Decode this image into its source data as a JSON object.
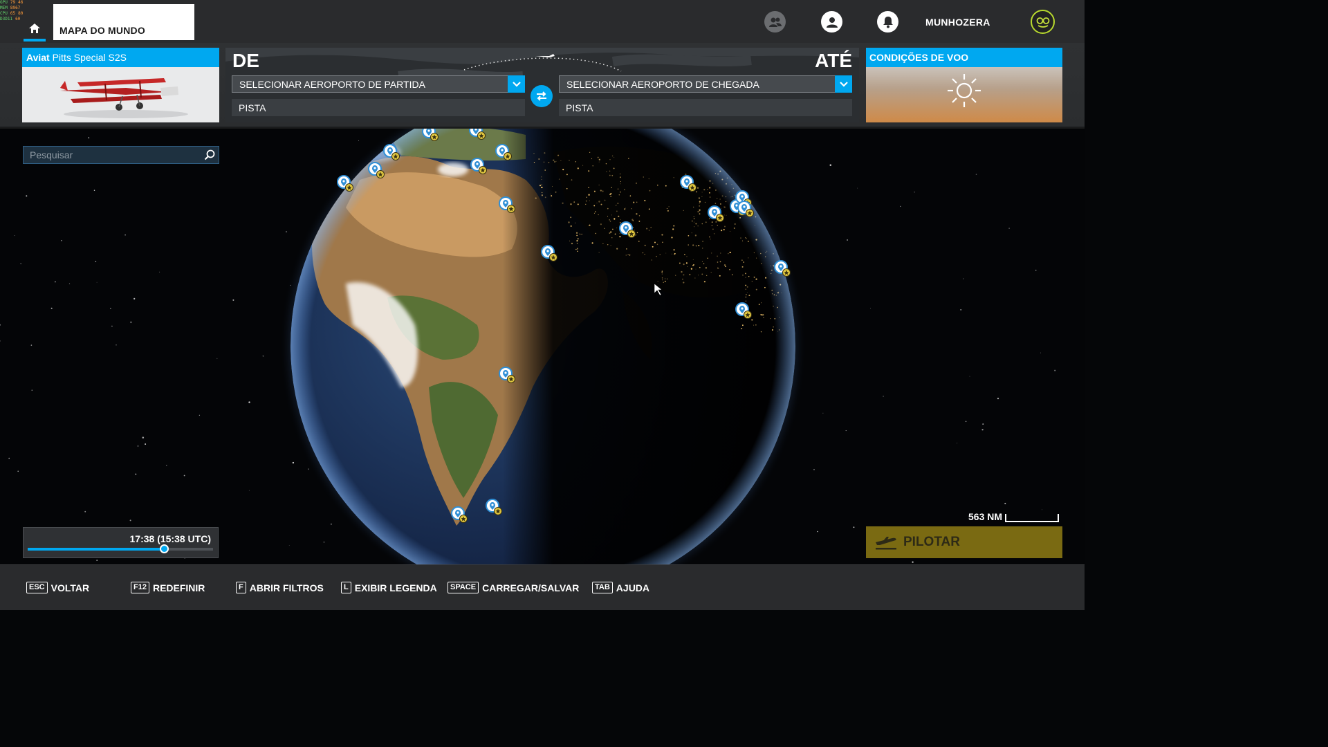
{
  "perf": {
    "rows": [
      {
        "label": "GPU",
        "value": "79",
        "extra": "46"
      },
      {
        "label": "MEM",
        "value": "8967",
        "extra": ""
      },
      {
        "label": "CPU",
        "value": "65",
        "extra": "80"
      },
      {
        "label": "D3D11",
        "value": "60",
        "extra": ""
      }
    ]
  },
  "header": {
    "breadcrumb": "MAPA DO MUNDO",
    "username": "MUNHOZERA"
  },
  "aircraft": {
    "maker": "Aviat",
    "model": "Pitts Special S2S"
  },
  "route": {
    "from_label": "DE",
    "to_label": "ATÉ",
    "departure_placeholder": "SELECIONAR AEROPORTO DE PARTIDA",
    "arrival_placeholder": "SELECIONAR AEROPORTO DE CHEGADA",
    "departure_runway": "PISTA",
    "arrival_runway": "PISTA"
  },
  "conditions": {
    "title": "CONDIÇÕES DE VOO",
    "weather_icon": "sun-icon"
  },
  "search": {
    "placeholder": "Pesquisar"
  },
  "time": {
    "label": "17:38 (15:38 UTC)",
    "slider_fraction": 0.735
  },
  "scale": {
    "label": "563 NM"
  },
  "pilot": {
    "label": "PILOTAR"
  },
  "hints": [
    {
      "key": "ESC",
      "label": "VOLTAR"
    },
    {
      "key": "F12",
      "label": "REDEFINIR"
    },
    {
      "key": "F",
      "label": "ABRIR FILTROS"
    },
    {
      "key": "L",
      "label": "EXIBIR LEGENDA"
    },
    {
      "key": "SPACE",
      "label": "CARREGAR/SALVAR"
    },
    {
      "key": "TAB",
      "label": "AJUDA"
    }
  ],
  "colors": {
    "accent": "#00a8f0",
    "bar": "#2a2b2d",
    "pilot": "#7a6a12"
  }
}
